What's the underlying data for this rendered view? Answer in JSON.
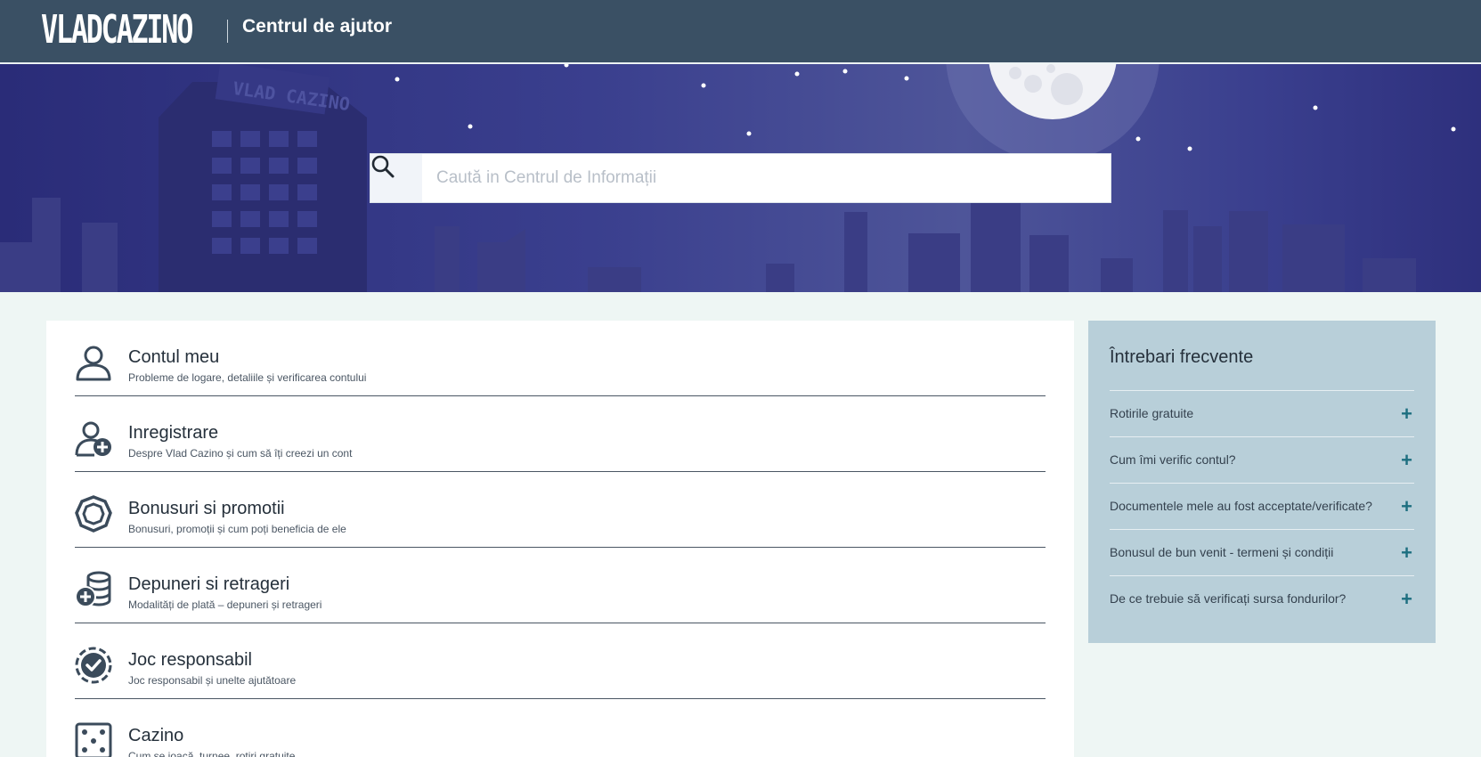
{
  "header": {
    "logo_text": "VLADCAZINO",
    "title": "Centrul de ajutor"
  },
  "search": {
    "placeholder": "Caută in Centrul de Informații",
    "value": ""
  },
  "categories": [
    {
      "title": "Contul meu",
      "desc": "Probleme de logare, detaliile și verificarea contului",
      "icon": "user-icon"
    },
    {
      "title": "Inregistrare",
      "desc": "Despre Vlad Cazino și cum să îți creezi un cont",
      "icon": "add-user-icon"
    },
    {
      "title": "Bonusuri si promotii",
      "desc": "Bonusuri, promoții și cum poți beneficia de ele",
      "icon": "bonus-gem-icon"
    },
    {
      "title": "Depuneri si retrageri",
      "desc": "Modalități de plată – depuneri și retrageri",
      "icon": "coins-plus-icon"
    },
    {
      "title": "Joc responsabil",
      "desc": "Joc responsabil și unelte ajutătoare",
      "icon": "chip-check-icon"
    },
    {
      "title": "Cazino",
      "desc": "Cum se joacă, turnee, rotiri gratuite",
      "icon": "dice-icon"
    }
  ],
  "faq": {
    "title": "Întrebari frecvente",
    "items": [
      "Rotirile gratuite",
      "Cum îmi verific contul?",
      "Documentele mele au fost acceptate/verificate?",
      "Bonusul de bun venit - termeni și condiții",
      "De ce trebuie să verificați sursa fondurilor?"
    ],
    "expand_symbol": "+"
  },
  "colors": {
    "header_bg": "#3a5064",
    "hero_bg": "#2e307d",
    "faq_bg": "#b8cfd9",
    "accent": "#1d6f80",
    "page_bg": "#eef6f4"
  }
}
